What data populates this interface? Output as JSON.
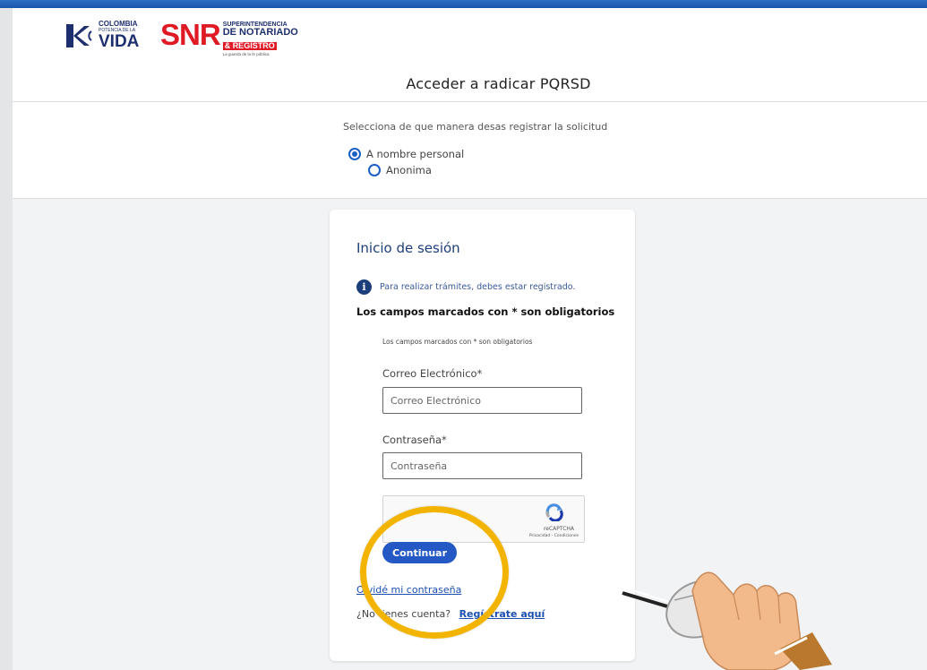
{
  "header": {
    "logo_colombia": {
      "line1": "COLOMBIA",
      "line2": "POTENCIA DE LA",
      "line3": "VIDA"
    },
    "logo_snr": {
      "acronym": "SNR",
      "line1": "SUPERINTENDENCIA",
      "line2": "DE NOTARIADO",
      "line3": "& REGISTRO",
      "tagline": "La guarda de la fe pública"
    },
    "page_title": "Acceder a radicar PQRSD"
  },
  "request_mode": {
    "prompt": "Selecciona de que manera desas registrar la solicitud",
    "options": [
      {
        "label": "A nombre personal",
        "selected": true
      },
      {
        "label": "Anonima",
        "selected": false
      }
    ]
  },
  "login_card": {
    "title": "Inicio de sesión",
    "info_text": "Para realizar trámites, debes estar registrado.",
    "required_notice": "Los campos marcados con * son obligatorios",
    "required_notice_small": "Los campos marcados con * son obligatorios",
    "email": {
      "label": "Correo Electrónico*",
      "placeholder": "Correo Electrónico",
      "value": ""
    },
    "password": {
      "label": "Contraseña*",
      "placeholder": "Contraseña",
      "value": ""
    },
    "recaptcha": {
      "brand": "reCAPTCHA",
      "links": "Privacidad - Condiciones"
    },
    "continue_label": "Continuar",
    "forgot_password": "Olvidé mi contraseña",
    "no_account": "¿No tienes cuenta?",
    "register_link": "Regístrate aquí"
  },
  "colors": {
    "accent_blue": "#2458c4",
    "title_blue": "#1c3e7a",
    "snr_red": "#e01a25",
    "highlight_yellow": "#f3b400",
    "page_background": "#f2f3f5"
  },
  "icons": {
    "info": "info-circle-icon",
    "recaptcha": "recaptcha-logo-icon",
    "cursor": "hand-mouse-cursor-icon",
    "colombia_mark": "colombia-logo-icon"
  }
}
